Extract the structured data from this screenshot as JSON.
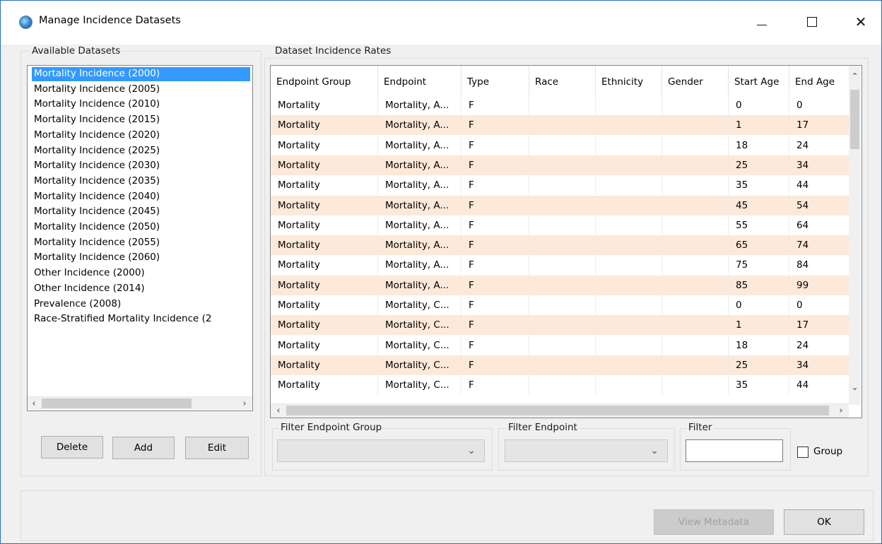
{
  "window": {
    "title": "Manage Incidence Datasets"
  },
  "available": {
    "legend": "Available Datasets",
    "items": [
      "Mortality Incidence (2000)",
      "Mortality Incidence (2005)",
      "Mortality Incidence (2010)",
      "Mortality Incidence (2015)",
      "Mortality Incidence (2020)",
      "Mortality Incidence (2025)",
      "Mortality Incidence (2030)",
      "Mortality Incidence (2035)",
      "Mortality Incidence (2040)",
      "Mortality Incidence (2045)",
      "Mortality Incidence (2050)",
      "Mortality Incidence (2055)",
      "Mortality Incidence (2060)",
      "Other Incidence (2000)",
      "Other Incidence (2014)",
      "Prevalence (2008)",
      "Race-Stratified Mortality Incidence (2"
    ],
    "selected_index": 0,
    "buttons": {
      "delete": "Delete",
      "add": "Add",
      "edit": "Edit"
    }
  },
  "rates": {
    "legend": "Dataset Incidence Rates",
    "columns": [
      "Endpoint Group",
      "Endpoint",
      "Type",
      "Race",
      "Ethnicity",
      "Gender",
      "Start Age",
      "End Age"
    ],
    "rows": [
      [
        "Mortality",
        "Mortality, A...",
        "F",
        "",
        "",
        "",
        "0",
        "0"
      ],
      [
        "Mortality",
        "Mortality, A...",
        "F",
        "",
        "",
        "",
        "1",
        "17"
      ],
      [
        "Mortality",
        "Mortality, A...",
        "F",
        "",
        "",
        "",
        "18",
        "24"
      ],
      [
        "Mortality",
        "Mortality, A...",
        "F",
        "",
        "",
        "",
        "25",
        "34"
      ],
      [
        "Mortality",
        "Mortality, A...",
        "F",
        "",
        "",
        "",
        "35",
        "44"
      ],
      [
        "Mortality",
        "Mortality, A...",
        "F",
        "",
        "",
        "",
        "45",
        "54"
      ],
      [
        "Mortality",
        "Mortality, A...",
        "F",
        "",
        "",
        "",
        "55",
        "64"
      ],
      [
        "Mortality",
        "Mortality, A...",
        "F",
        "",
        "",
        "",
        "65",
        "74"
      ],
      [
        "Mortality",
        "Mortality, A...",
        "F",
        "",
        "",
        "",
        "75",
        "84"
      ],
      [
        "Mortality",
        "Mortality, A...",
        "F",
        "",
        "",
        "",
        "85",
        "99"
      ],
      [
        "Mortality",
        "Mortality, C...",
        "F",
        "",
        "",
        "",
        "0",
        "0"
      ],
      [
        "Mortality",
        "Mortality, C...",
        "F",
        "",
        "",
        "",
        "1",
        "17"
      ],
      [
        "Mortality",
        "Mortality, C...",
        "F",
        "",
        "",
        "",
        "18",
        "24"
      ],
      [
        "Mortality",
        "Mortality, C...",
        "F",
        "",
        "",
        "",
        "25",
        "34"
      ],
      [
        "Mortality",
        "Mortality, C...",
        "F",
        "",
        "",
        "",
        "35",
        "44"
      ]
    ],
    "alt_row_color": "#fde9d9"
  },
  "filters": {
    "endpoint_group_legend": "Filter Endpoint Group",
    "endpoint_legend": "Filter Endpoint",
    "filter_legend": "Filter",
    "filter_value": "",
    "group_label": "Group"
  },
  "footer": {
    "view_metadata": "View Metadata",
    "ok": "OK"
  }
}
